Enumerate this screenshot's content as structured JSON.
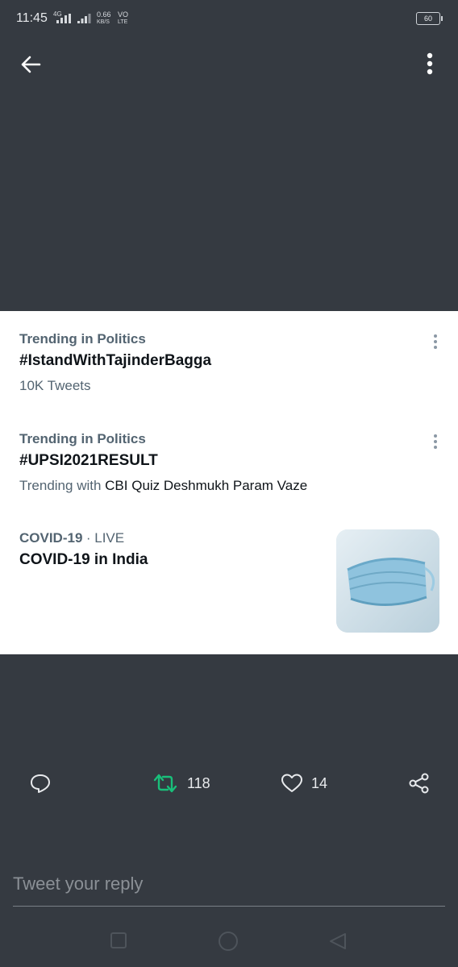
{
  "status_bar": {
    "time": "11:45",
    "network_4g": "4G",
    "speed_value": "0.66",
    "speed_unit": "KB/S",
    "volte_top": "VO",
    "volte_bottom": "LTE",
    "battery": "60"
  },
  "header": {
    "back_icon": "arrow-left-icon",
    "more_icon": "more-vertical-icon"
  },
  "trends": [
    {
      "category": "Trending in Politics",
      "title": "#IstandWithTajinderBagga",
      "meta": "10K Tweets"
    },
    {
      "category": "Trending in Politics",
      "title": "#UPSI2021RESULT",
      "meta_prefix": "Trending with",
      "meta_topics": "CBI Quiz Deshmukh Param Vaze"
    },
    {
      "category": "COVID-19",
      "live_label": "· LIVE",
      "title": "COVID-19 in India",
      "thumbnail_icon": "face-mask-image"
    }
  ],
  "actions": {
    "reply_icon": "comment-icon",
    "retweet_count": "118",
    "like_count": "14",
    "share_icon": "share-icon",
    "retweet_color": "#19bf7a"
  },
  "reply_box": {
    "placeholder": "Tweet your reply"
  },
  "nav": {
    "icons": [
      "square-icon",
      "circle-icon",
      "triangle-back-icon"
    ]
  }
}
